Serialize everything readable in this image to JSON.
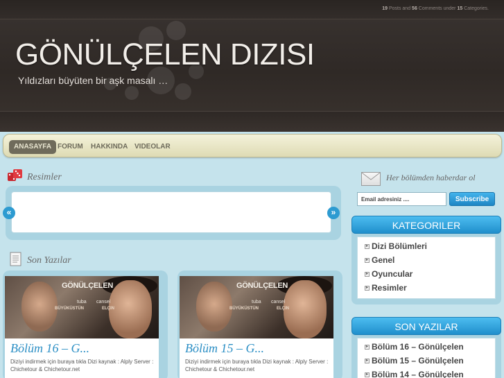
{
  "header": {
    "stats": {
      "posts": "19",
      "posts_label": "Posts and",
      "comments": "56",
      "comments_label": "Comments under",
      "categories": "15",
      "categories_label": "Categories."
    },
    "site_title": "GÖNÜLÇELEN DIZISI",
    "site_description": "Yıldızları büyüten bir aşk masalı …"
  },
  "nav": {
    "items": [
      {
        "label": "ANASAYFA"
      },
      {
        "label": "FORUM"
      },
      {
        "label": "HAKKINDA"
      },
      {
        "label": "VIDEOLAR"
      }
    ]
  },
  "main": {
    "gallery_heading": "Resimler",
    "gallery_prev": "«",
    "gallery_next": "»",
    "posts_heading": "Son Yazılar",
    "posts": [
      {
        "thumb_title": "GÖNÜLÇELEN",
        "thumb_names": [
          "tuba",
          "BÜYÜKÜSTÜN",
          "cansel",
          "ELÇIN"
        ],
        "title": "Bölüm 16 – G...",
        "excerpt": "Diziyi indirmek için buraya tıkla Dizi kaynak : Alply   Server : Chichetour & Chichetour.net"
      },
      {
        "thumb_title": "GÖNÜLÇELEN",
        "thumb_names": [
          "tuba",
          "BÜYÜKÜSTÜN",
          "cansel",
          "ELÇIN"
        ],
        "title": "Bölüm 15 – G...",
        "excerpt": "Diziyi indirmek için buraya tıkla Dizi kaynak : Alply   Server : Chichetour & Chichetour.net"
      }
    ]
  },
  "sidebar": {
    "subscribe_heading": "Her bölümden haberdar ol",
    "email_placeholder": "Email adresiniz ....",
    "subscribe_button": "Subscribe",
    "categories_title": "KATEGORILER",
    "categories": [
      "Dizi Bölümleri",
      "Genel",
      "Oyuncular",
      "Resimler"
    ],
    "recent_title": "SON YAZILAR",
    "recent": [
      "Bölüm 16 – Gönülçelen",
      "Bölüm 15 – Gönülçelen",
      "Bölüm 14 – Gönülçelen"
    ]
  },
  "colors": {
    "accent": "#2d9bd1",
    "header_bg": "#2f2926",
    "nav_bg": "#e9e6c6",
    "page_bg": "#c5e3ec"
  }
}
